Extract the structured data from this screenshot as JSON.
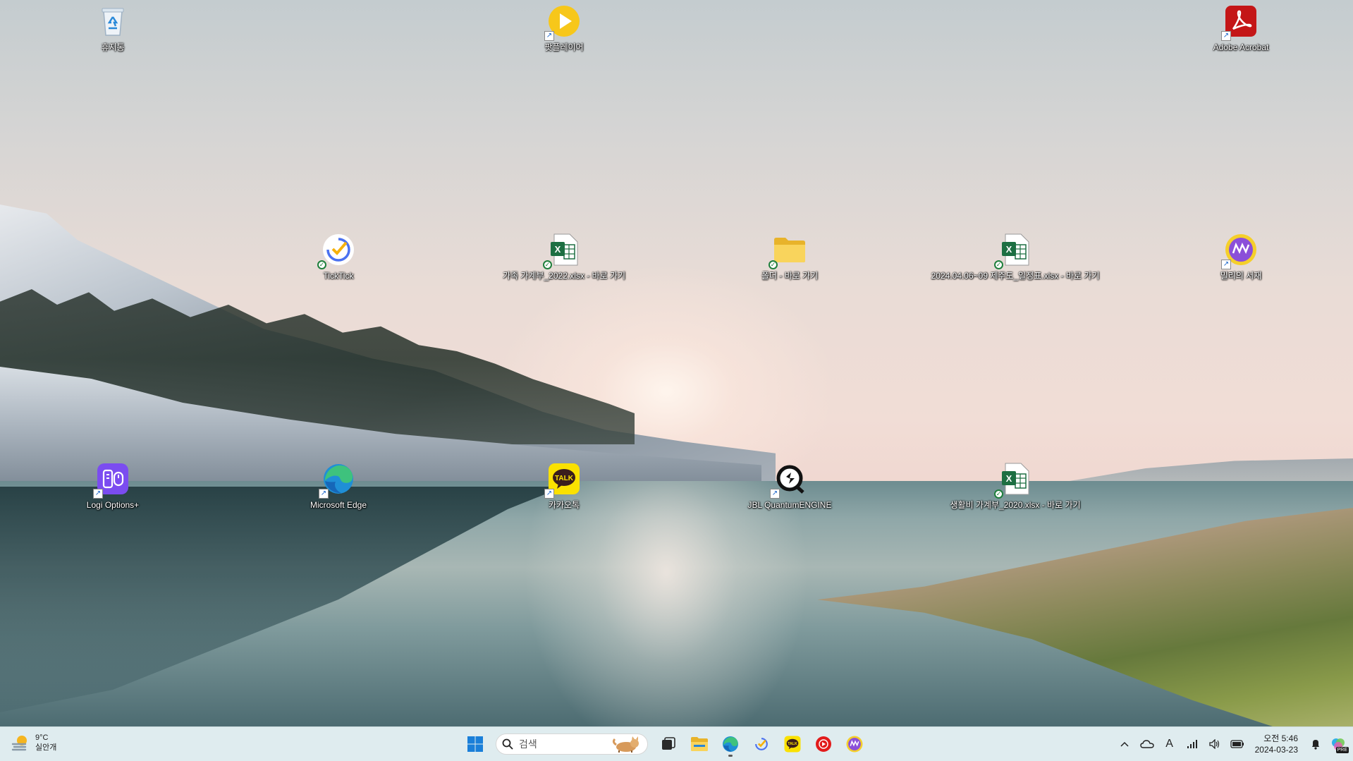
{
  "desktop": {
    "icons": [
      {
        "id": "recycle",
        "label": "휴지통"
      },
      {
        "id": "potplayer",
        "label": "팟플레이어"
      },
      {
        "id": "acrobat",
        "label": "Adobe Acrobat"
      },
      {
        "id": "ticktick",
        "label": "TickTick"
      },
      {
        "id": "xlsx2022",
        "label": "가족 가계부_2022.xlsx - 바로 가기"
      },
      {
        "id": "folder",
        "label": "폴더 - 바로 가기"
      },
      {
        "id": "xlsx2024",
        "label": "2024.04.06~09 제주도_일정표.xlsx - 바로 가기"
      },
      {
        "id": "millie",
        "label": "밀리의 서재"
      },
      {
        "id": "logi",
        "label": "Logi Options+"
      },
      {
        "id": "edge",
        "label": "Microsoft Edge"
      },
      {
        "id": "kakao",
        "label": "카카오톡"
      },
      {
        "id": "quantum",
        "label": "JBL QuantumENGINE"
      },
      {
        "id": "xlsx2020",
        "label": "생활비 가계부_2020.xlsx - 바로 가기"
      }
    ]
  },
  "taskbar": {
    "weather": {
      "temp": "9°C",
      "desc": "실안개"
    },
    "search": {
      "placeholder": "검색"
    },
    "clock": {
      "time": "오전 5:46",
      "date": "2024-03-23"
    },
    "ime": "A",
    "copilot_badge": "PRE"
  }
}
